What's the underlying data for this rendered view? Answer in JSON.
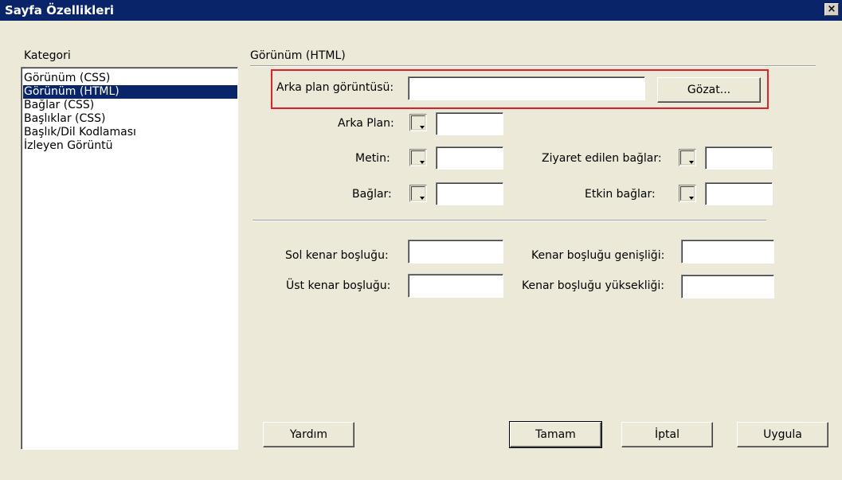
{
  "window": {
    "title": "Sayfa Özellikleri",
    "close_glyph": "×"
  },
  "category": {
    "header": "Kategori",
    "items": [
      {
        "label": "Görünüm (CSS)",
        "selected": false
      },
      {
        "label": "Görünüm (HTML)",
        "selected": true
      },
      {
        "label": "Bağlar (CSS)",
        "selected": false
      },
      {
        "label": "Başlıklar (CSS)",
        "selected": false
      },
      {
        "label": "Başlık/Dil Kodlaması",
        "selected": false
      },
      {
        "label": "İzleyen Görüntü",
        "selected": false
      }
    ]
  },
  "section": {
    "title": "Görünüm (HTML)"
  },
  "background_image": {
    "label": "Arka plan görüntüsü:",
    "value": "",
    "browse_label": "Gözat..."
  },
  "colors": {
    "background": {
      "label": "Arka Plan:",
      "value": ""
    },
    "text": {
      "label": "Metin:",
      "value": ""
    },
    "links": {
      "label": "Bağlar:",
      "value": ""
    },
    "visited_links": {
      "label": "Ziyaret edilen bağlar:",
      "value": ""
    },
    "active_links": {
      "label": "Etkin bağlar:",
      "value": ""
    }
  },
  "margins": {
    "left": {
      "label": "Sol kenar boşluğu:",
      "value": ""
    },
    "top": {
      "label": "Üst kenar boşluğu:",
      "value": ""
    },
    "width": {
      "label": "Kenar boşluğu genişliği:",
      "value": ""
    },
    "height": {
      "label": "Kenar boşluğu yüksekliği:",
      "value": ""
    }
  },
  "buttons": {
    "help": "Yardım",
    "ok": "Tamam",
    "cancel": "İptal",
    "apply": "Uygula"
  },
  "accent": {
    "titlebar": "#0a246a",
    "highlight_border": "#e0202a"
  }
}
